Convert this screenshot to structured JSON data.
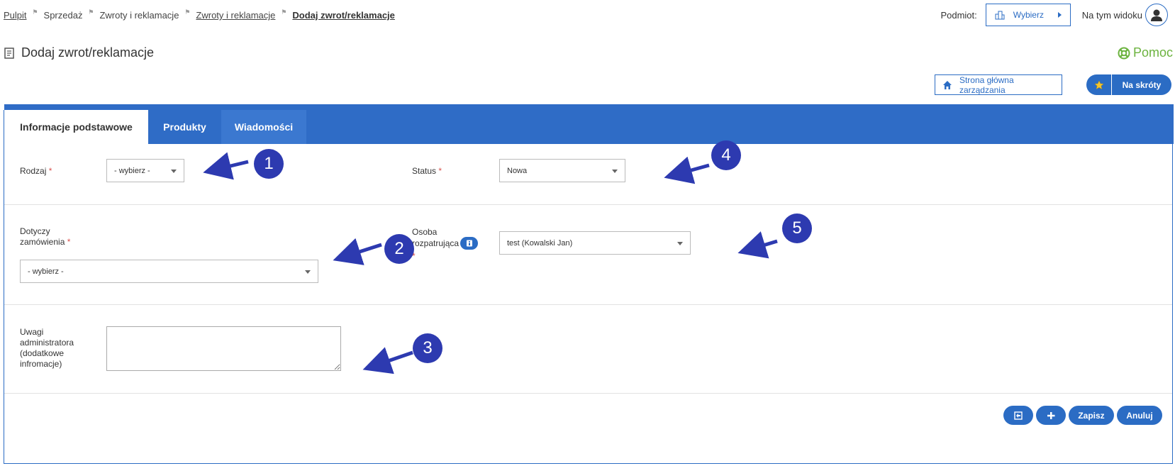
{
  "breadcrumb": [
    {
      "label": "Pulpit",
      "link": true
    },
    {
      "label": "Sprzedaż",
      "link": false
    },
    {
      "label": "Zwroty i reklamacje",
      "link": false
    },
    {
      "label": "Zwroty i reklamacje",
      "link": true
    },
    {
      "label": "Dodaj zwrot/reklamacje",
      "link": true,
      "current": true
    }
  ],
  "topbar": {
    "podmiot_label": "Podmiot:",
    "wybierz_label": "Wybierz",
    "view_label": "Na tym widoku"
  },
  "page": {
    "title": "Dodaj zwrot/reklamacje",
    "help": "Pomoc",
    "home_button": "Strona główna zarządzania",
    "shortcuts_button": "Na skróty"
  },
  "tabs": [
    {
      "label": "Informacje podstawowe",
      "active": true
    },
    {
      "label": "Produkty",
      "active": false
    },
    {
      "label": "Wiadomości",
      "active": false
    }
  ],
  "form": {
    "rodzaj": {
      "label": "Rodzaj",
      "required": "*",
      "value": "- wybierz -"
    },
    "status": {
      "label": "Status",
      "required": "*",
      "value": "Nowa"
    },
    "zamowienie": {
      "label_line1": "Dotyczy",
      "label_line2": "zamówienia",
      "required": "*",
      "value": "- wybierz -"
    },
    "osoba": {
      "label_line1": "Osoba",
      "label_line2": "rozpatrująca",
      "required": "*",
      "value": "test (Kowalski Jan)"
    },
    "uwagi": {
      "label_line1": "Uwagi",
      "label_line2": "administratora",
      "label_line3": "(dodatkowe",
      "label_line4": "infromacje)",
      "value": ""
    }
  },
  "actions": {
    "save": "Zapisz",
    "cancel": "Anuluj"
  },
  "annotations": [
    "1",
    "2",
    "3",
    "4",
    "5"
  ],
  "colors": {
    "primary": "#2f6cc6",
    "annotation": "#2d3ab0",
    "help_green": "#6cb33f",
    "required_red": "#d9534f"
  }
}
